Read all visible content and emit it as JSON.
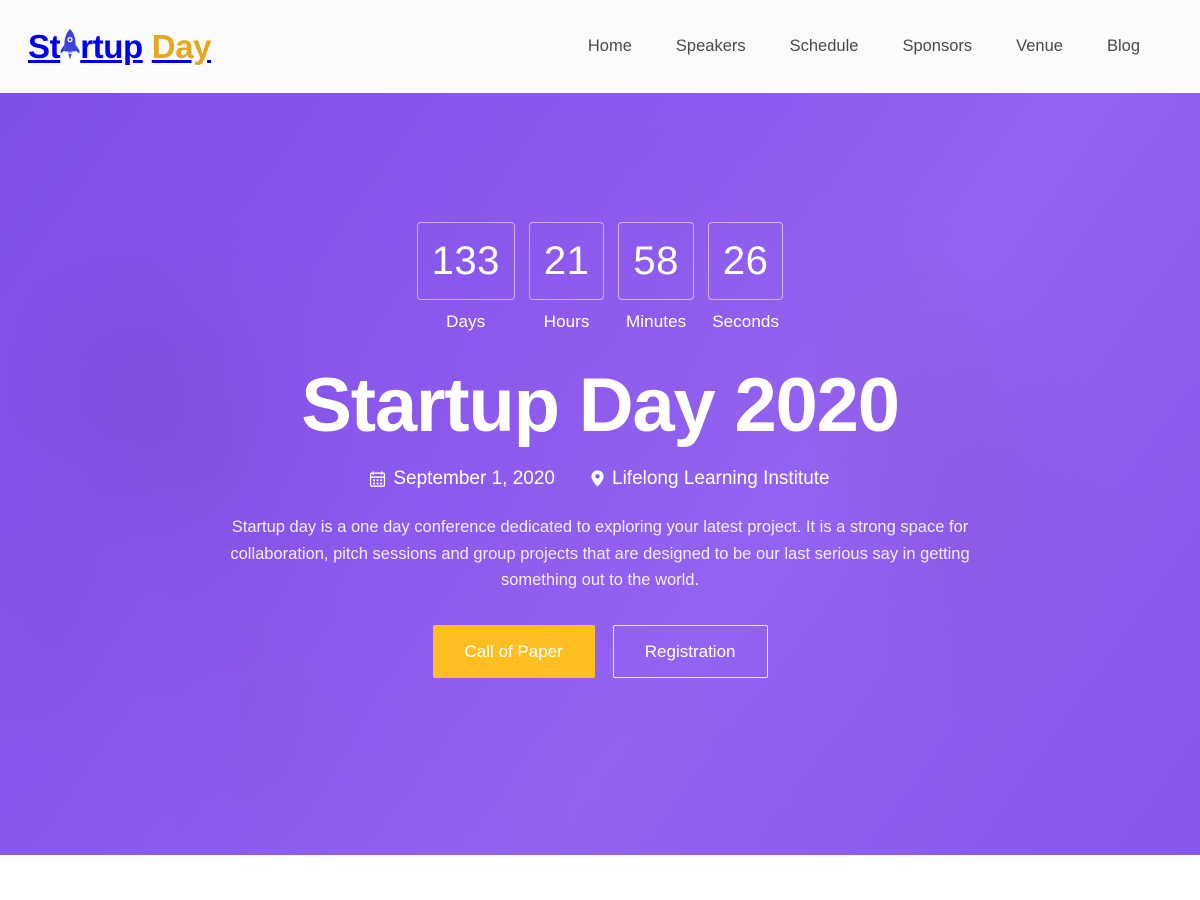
{
  "header": {
    "brand": {
      "part1": "St",
      "icon": "rocket-icon",
      "part2": "rtup",
      "part3": "Day",
      "color_primary": "#3b44d6",
      "color_accent": "#e3a820"
    },
    "nav": [
      {
        "label": "Home"
      },
      {
        "label": "Speakers"
      },
      {
        "label": "Schedule"
      },
      {
        "label": "Sponsors"
      },
      {
        "label": "Venue"
      },
      {
        "label": "Blog"
      }
    ]
  },
  "hero": {
    "countdown": [
      {
        "value": "133",
        "label": "Days"
      },
      {
        "value": "21",
        "label": "Hours"
      },
      {
        "value": "58",
        "label": "Minutes"
      },
      {
        "value": "26",
        "label": "Seconds"
      }
    ],
    "title": "Startup Day 2020",
    "meta": {
      "date_icon": "calendar-icon",
      "date": "September 1, 2020",
      "location_icon": "map-marker-icon",
      "location": "Lifelong Learning Institute"
    },
    "description": "Startup day is a one day conference dedicated to exploring your latest project. It is a strong space for collaboration, pitch sessions and group projects that are designed to be our last serious say in getting something out to the world.",
    "actions": {
      "primary_label": "Call of Paper",
      "secondary_label": "Registration"
    },
    "colors": {
      "overlay_purple": "#8a57ee",
      "primary_button": "#fdbe1f",
      "text": "#ffffff"
    }
  }
}
